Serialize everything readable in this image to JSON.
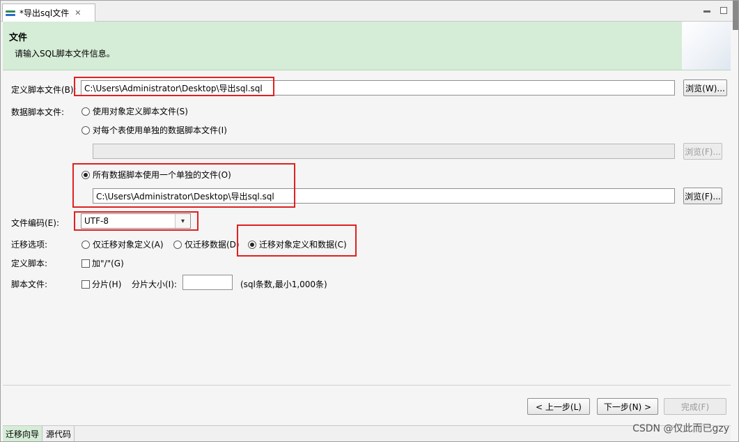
{
  "tab": {
    "title": "*导出sql文件",
    "close": "✕"
  },
  "header": {
    "title": "文件",
    "description": "请输入SQL脚本文件信息。"
  },
  "form": {
    "def_script_label": "定义脚本文件(B):",
    "def_script_value": "C:\\Users\\Administrator\\Desktop\\导出sql.sql",
    "browse_w": "浏览(W)...",
    "data_script_label": "数据脚本文件:",
    "radio_use_def": "使用对象定义脚本文件(S)",
    "radio_each_table": "对每个表使用单独的数据脚本文件(I)",
    "each_table_value": "",
    "browse_f1": "浏览(F)...",
    "radio_single_file": "所有数据脚本使用一个单独的文件(O)",
    "single_file_value": "C:\\Users\\Administrator\\Desktop\\导出sql.sql",
    "browse_f2": "浏览(F)...",
    "encoding_label": "文件编码(E):",
    "encoding_value": "UTF-8",
    "migrate_label": "迁移选项:",
    "migrate_def_only": "仅迁移对象定义(A)",
    "migrate_data_only": "仅迁移数据(D)",
    "migrate_both": "迁移对象定义和数据(C)",
    "def_script2_label": "定义脚本:",
    "add_slash": "加\"/\"(G)",
    "script_file_label": "脚本文件:",
    "split": "分片(H)",
    "split_size_label": "分片大小(I):",
    "split_size_value": "",
    "split_hint": "(sql条数,最小1,000条)"
  },
  "footer": {
    "prev": "< 上一步(L)",
    "next": "下一步(N) >",
    "finish": "完成(F)"
  },
  "bottom_tabs": [
    "迁移向导",
    "源代码"
  ],
  "watermark": "CSDN @仅此而已gzy",
  "colors": {
    "header_bg": "#d5ecd6",
    "highlight": "#e02020"
  }
}
